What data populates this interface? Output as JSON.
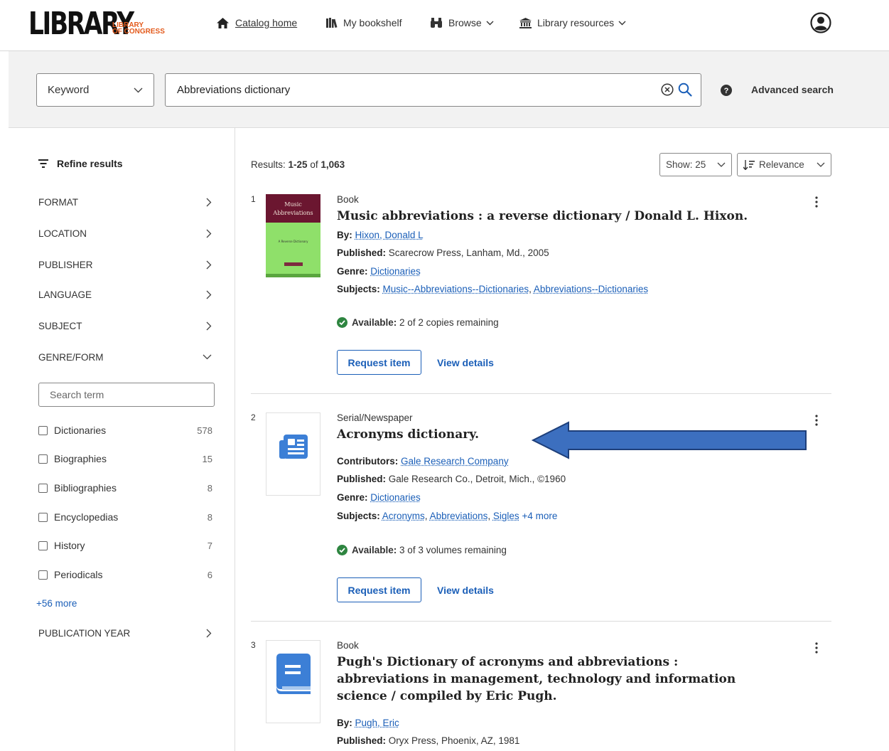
{
  "header": {
    "logo_main": "LIBRARY",
    "logo_sub_1": "LIBRARY",
    "logo_sub_2": "OF CONGRESS",
    "nav": {
      "catalog_home": "Catalog home",
      "my_bookshelf": "My bookshelf",
      "browse": "Browse",
      "library_resources": "Library resources"
    }
  },
  "search": {
    "type_selected": "Keyword",
    "query": "Abbreviations dictionary",
    "advanced": "Advanced search"
  },
  "sidebar": {
    "refine_label": "Refine results",
    "facets": {
      "format": "FORMAT",
      "location": "LOCATION",
      "publisher": "PUBLISHER",
      "language": "LANGUAGE",
      "subject": "SUBJECT",
      "genre": "GENRE/FORM",
      "pubyear": "PUBLICATION YEAR"
    },
    "genre_search_placeholder": "Search term",
    "genre_options": [
      {
        "label": "Dictionaries",
        "count": "578"
      },
      {
        "label": "Biographies",
        "count": "15"
      },
      {
        "label": "Bibliographies",
        "count": "8"
      },
      {
        "label": "Encyclopedias",
        "count": "8"
      },
      {
        "label": "History",
        "count": "7"
      },
      {
        "label": "Periodicals",
        "count": "6"
      }
    ],
    "more": "+56 more"
  },
  "results_header": {
    "prefix": "Results: ",
    "range": "1-25",
    "of": " of ",
    "total": "1,063",
    "show": "Show: 25",
    "sort": "Relevance"
  },
  "results": [
    {
      "num": "1",
      "type": "Book",
      "title": "Music abbreviations : a reverse dictionary / Donald L. Hixon.",
      "cover_title": "Music Abbreviations",
      "cover_sub": "A Reverse Dictionary",
      "by_label": "By:",
      "by": "Hixon, Donald L",
      "published_label": "Published:",
      "published": "Scarecrow Press, Lanham, Md., 2005",
      "genre_label": "Genre:",
      "genre": "Dictionaries",
      "subjects_label": "Subjects:",
      "subject_1": "Music--Abbreviations--Dictionaries",
      "subject_2": "Abbreviations--Dictionaries",
      "available_label": "Available:",
      "available": "2 of 2 copies remaining",
      "request": "Request item",
      "details": "View details"
    },
    {
      "num": "2",
      "type": "Serial/Newspaper",
      "title": "Acronyms dictionary.",
      "contributors_label": "Contributors:",
      "contributors": "Gale Research Company",
      "published_label": "Published:",
      "published": "Gale Research Co., Detroit, Mich., ©1960",
      "genre_label": "Genre:",
      "genre": "Dictionaries",
      "subjects_label": "Subjects:",
      "subject_1": "Acronyms",
      "subject_2": "Abbreviations",
      "subject_3": "Sigles",
      "more_subjects": "+4 more",
      "available_label": "Available:",
      "available": "3 of 3 volumes remaining",
      "request": "Request item",
      "details": "View details"
    },
    {
      "num": "3",
      "type": "Book",
      "title": "Pugh's Dictionary of acronyms and abbreviations : abbreviations in management, technology and information science / compiled by Eric Pugh.",
      "by_label": "By:",
      "by": "Pugh, Eric",
      "published_label": "Published:",
      "published": "Oryx Press, Phoenix, AZ, 1981"
    }
  ],
  "colors": {
    "link": "#1b5fb8",
    "logo_accent": "#e35a1c",
    "available_green": "#2e8540",
    "arrow_fill": "#3c6fbf"
  }
}
